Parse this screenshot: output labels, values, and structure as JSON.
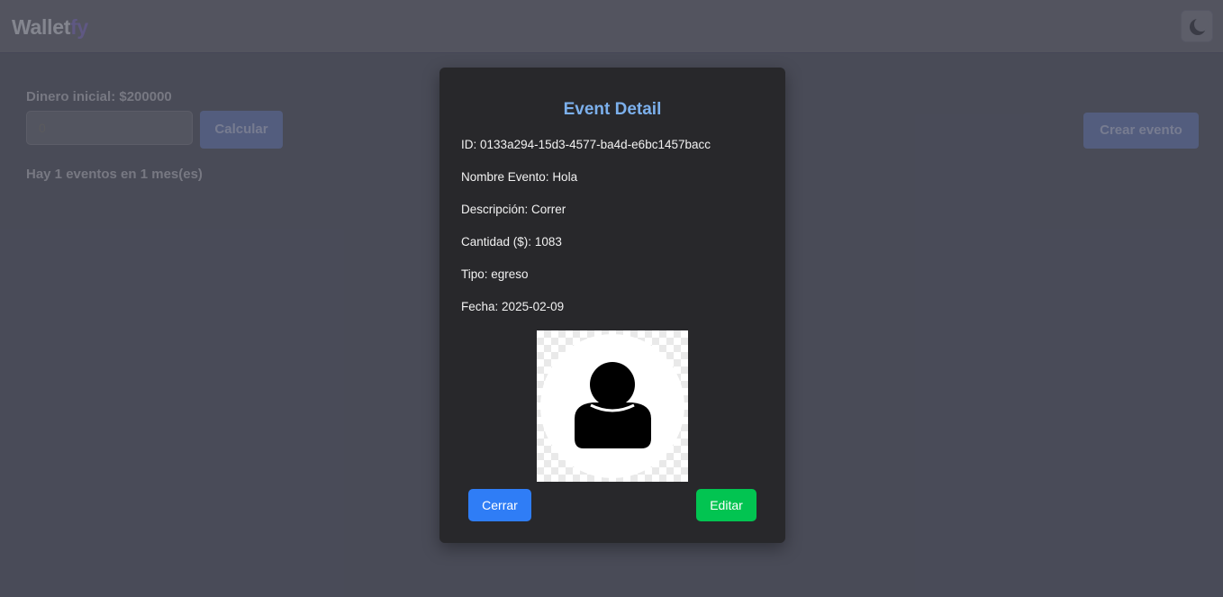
{
  "header": {
    "brand_main": "Wallet",
    "brand_accent": "fy",
    "theme_toggle_icon": "moon-icon"
  },
  "main": {
    "dinero_label": "Dinero inicial: $200000",
    "months_input_placeholder": "0",
    "calcular_label": "Calcular",
    "events_info": "Hay 1 eventos en 1 mes(es)",
    "crear_evento_label": "Crear evento"
  },
  "modal": {
    "title": "Event Detail",
    "fields": [
      {
        "label": "ID:",
        "value": "0133a294-15d3-4577-ba4d-e6bc1457bacc"
      },
      {
        "label": "Nombre Evento:",
        "value": "Hola"
      },
      {
        "label": "Descripción:",
        "value": "Correr"
      },
      {
        "label": "Cantidad ($):",
        "value": "1083"
      },
      {
        "label": "Tipo:",
        "value": "egreso"
      },
      {
        "label": "Fecha:",
        "value": "2025-02-09"
      }
    ],
    "image_icon": "user-avatar-icon",
    "cerrar_label": "Cerrar",
    "editar_label": "Editar"
  },
  "colors": {
    "title": "#7cb0ec",
    "cerrar_button": "#2f7df6",
    "editar_button": "#02c451",
    "modal_bg": "#28282b"
  }
}
